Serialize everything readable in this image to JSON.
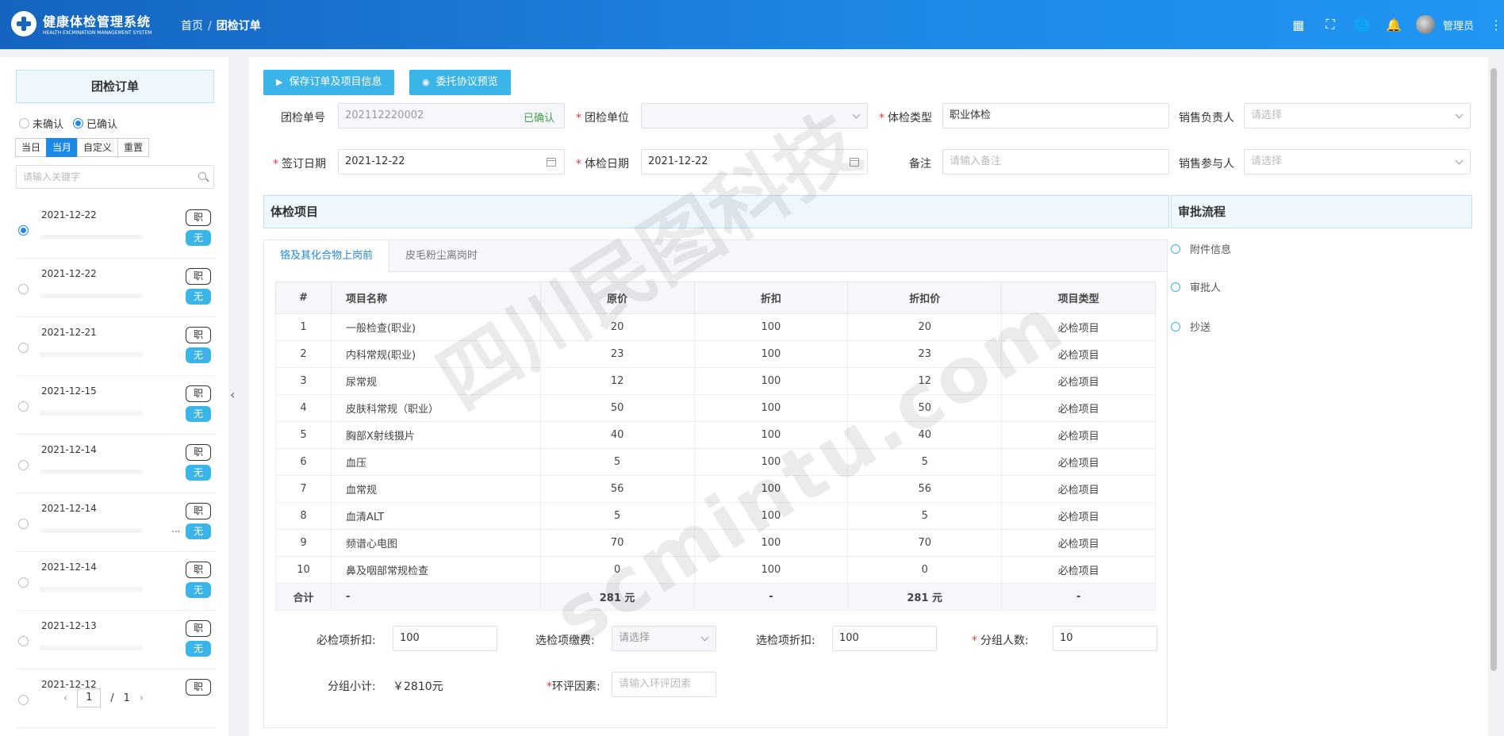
{
  "header": {
    "brand_cn": "健康体检管理系统",
    "brand_en": "HEALTH EXCMINATION MANAGEMENT SYSTEM",
    "breadcrumb": [
      "首页",
      "团检订单"
    ],
    "user": "管理员",
    "icons": [
      "grid-icon",
      "fullscreen-icon",
      "globe-icon",
      "bell-icon",
      "more-icon"
    ]
  },
  "left": {
    "title": "团检订单",
    "radio_options": [
      {
        "label": "未确认",
        "checked": false
      },
      {
        "label": "已确认",
        "checked": true
      }
    ],
    "date_filters": [
      "当日",
      "当月",
      "自定义",
      "重置"
    ],
    "active_filter": "当月",
    "search_placeholder": "请输入关键字",
    "orders": [
      {
        "date": "2021-12-22",
        "type": "职",
        "status": "无",
        "selected": true
      },
      {
        "date": "2021-12-22",
        "type": "职",
        "status": "无"
      },
      {
        "date": "2021-12-21",
        "type": "职",
        "status": "无"
      },
      {
        "date": "2021-12-15",
        "type": "职",
        "status": "无"
      },
      {
        "date": "2021-12-14",
        "type": "职",
        "status": "无"
      },
      {
        "date": "2021-12-14",
        "type": "职",
        "status": "无",
        "extra": "..."
      },
      {
        "date": "2021-12-14",
        "type": "职",
        "status": "无"
      },
      {
        "date": "2021-12-13",
        "type": "职",
        "status": "无"
      },
      {
        "date": "2021-12-12",
        "type": "职",
        "status": ""
      }
    ],
    "pager": {
      "current": "1",
      "separator": "/",
      "total": "1"
    }
  },
  "toolbar": {
    "save_label": "保存订单及项目信息",
    "preview_label": "委托协议预览"
  },
  "form": {
    "order_no_label": "团检单号",
    "order_no_value": "202112220002",
    "order_status": "已确认",
    "unit_label": "团检单位",
    "exam_type_label": "体检类型",
    "exam_type_value": "职业体检",
    "sales_owner_label": "销售负责人",
    "sales_owner_placeholder": "请选择",
    "sign_date_label": "签订日期",
    "sign_date_value": "2021-12-22",
    "exam_date_label": "体检日期",
    "exam_date_value": "2021-12-22",
    "remark_label": "备注",
    "remark_placeholder": "请输入备注",
    "sales_participant_label": "销售参与人",
    "sales_participant_placeholder": "请选择"
  },
  "items_section": {
    "title": "体检项目",
    "tabs": [
      "铬及其化合物上岗前",
      "皮毛粉尘离岗时"
    ],
    "columns": [
      "#",
      "项目名称",
      "原价",
      "折扣",
      "折扣价",
      "项目类型"
    ],
    "rows": [
      [
        "1",
        "一般检查(职业)",
        "20",
        "100",
        "20",
        "必检项目"
      ],
      [
        "2",
        "内科常规(职业)",
        "23",
        "100",
        "23",
        "必检项目"
      ],
      [
        "3",
        "尿常规",
        "12",
        "100",
        "12",
        "必检项目"
      ],
      [
        "4",
        "皮肤科常规（职业）",
        "50",
        "100",
        "50",
        "必检项目"
      ],
      [
        "5",
        "胸部X射线摄片",
        "40",
        "100",
        "40",
        "必检项目"
      ],
      [
        "6",
        "血压",
        "5",
        "100",
        "5",
        "必检项目"
      ],
      [
        "7",
        "血常规",
        "56",
        "100",
        "56",
        "必检项目"
      ],
      [
        "8",
        "血清ALT",
        "5",
        "100",
        "5",
        "必检项目"
      ],
      [
        "9",
        "频谱心电图",
        "70",
        "100",
        "70",
        "必检项目"
      ],
      [
        "10",
        "鼻及咽部常规检查",
        "0",
        "100",
        "0",
        "必检项目"
      ]
    ],
    "sum_row": [
      "合计",
      "-",
      "281 元",
      "-",
      "281 元",
      "-"
    ],
    "required_discount_label": "必检项折扣:",
    "required_discount_value": "100",
    "optional_fee_label": "选检项缴费:",
    "optional_fee_placeholder": "请选择",
    "optional_discount_label": "选检项折扣:",
    "optional_discount_value": "100",
    "group_count_label": "分组人数:",
    "group_count_value": "10",
    "subtotal_label": "分组小计:",
    "subtotal_value": "￥2810元",
    "env_factor_label": "环评因素:",
    "env_factor_placeholder": "请输入环评因素"
  },
  "approval": {
    "title": "审批流程",
    "steps": [
      "附件信息",
      "审批人",
      "抄送"
    ]
  },
  "watermark": {
    "cn": "四川民图科技",
    "en": "scmintu.com"
  }
}
